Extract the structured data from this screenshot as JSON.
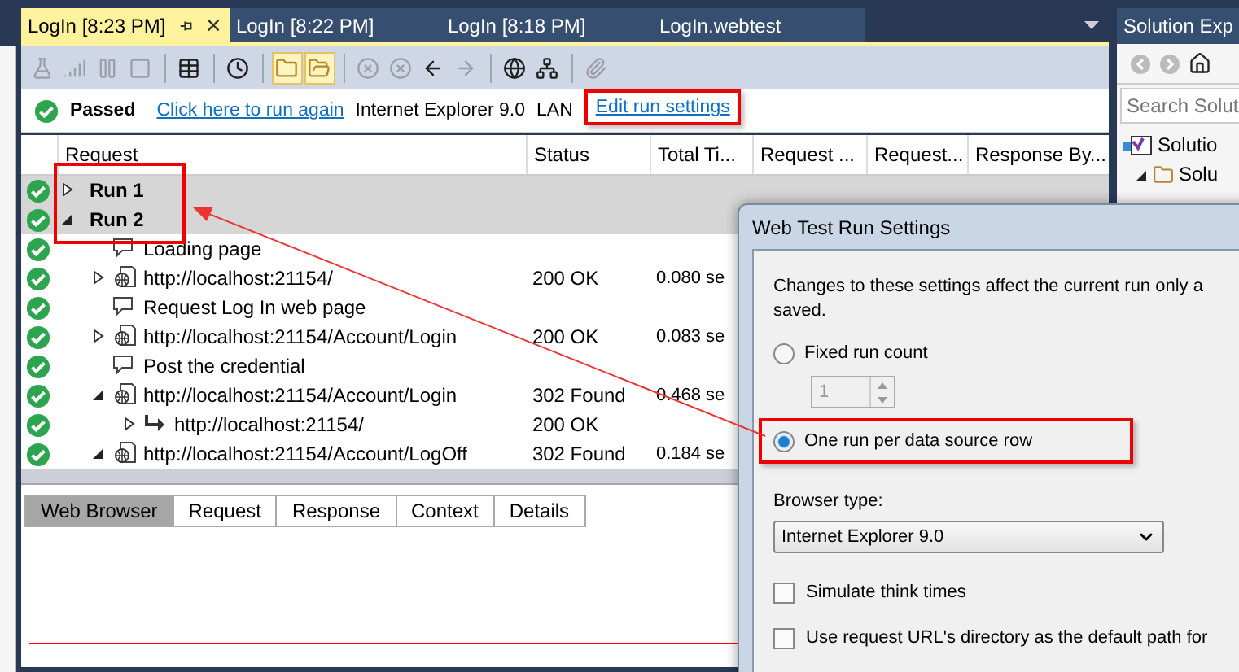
{
  "tabs": [
    {
      "label": "LogIn [8:23 PM]",
      "selected": true
    },
    {
      "label": "LogIn [8:22 PM]",
      "selected": false
    },
    {
      "label": "LogIn [8:18 PM]",
      "selected": false
    },
    {
      "label": "LogIn.webtest",
      "selected": false
    }
  ],
  "toolbar": [
    {
      "kind": "run",
      "disabled": true,
      "selected": false
    },
    {
      "kind": "step",
      "disabled": true,
      "selected": false
    },
    {
      "kind": "pause",
      "disabled": true,
      "selected": false
    },
    {
      "kind": "stop",
      "disabled": true,
      "selected": false
    },
    {
      "kind": "export",
      "disabled": false,
      "selected": false
    },
    {
      "kind": "history",
      "disabled": false,
      "selected": false
    },
    {
      "kind": "folder",
      "disabled": false,
      "selected": true
    },
    {
      "kind": "openfolder",
      "disabled": false,
      "selected": true
    },
    {
      "kind": "remove",
      "disabled": true,
      "selected": false
    },
    {
      "kind": "removeall",
      "disabled": true,
      "selected": false
    },
    {
      "kind": "back",
      "disabled": false,
      "selected": false
    },
    {
      "kind": "forward",
      "disabled": true,
      "selected": false
    },
    {
      "kind": "globe",
      "disabled": false,
      "selected": false
    },
    {
      "kind": "network",
      "disabled": false,
      "selected": false
    },
    {
      "kind": "attach",
      "disabled": true,
      "selected": false
    }
  ],
  "result_bar": {
    "passed": true,
    "status": "Passed",
    "run_again_link": "Click here to run again",
    "browser": "Internet Explorer 9.0",
    "network": "LAN",
    "settings_link": "Edit run settings"
  },
  "table": {
    "columns": [
      "Request",
      "Status",
      "Total Ti...",
      "Request ...",
      "Request...",
      "Response By..."
    ],
    "rows": [
      {
        "kind": "run",
        "label": "Run 1",
        "passed": true,
        "expanded": false
      },
      {
        "kind": "run",
        "label": "Run 2",
        "passed": true,
        "expanded": true,
        "children": [
          {
            "kind": "comment",
            "label": "Loading page",
            "passed": true
          },
          {
            "kind": "request",
            "label": "http://localhost:21154/",
            "status": "200 OK",
            "time": "0.080 se",
            "passed": true,
            "expanded": false
          },
          {
            "kind": "comment",
            "label": "Request Log In web page",
            "passed": true
          },
          {
            "kind": "request",
            "label": "http://localhost:21154/Account/Login",
            "status": "200 OK",
            "time": "0.083 se",
            "passed": true,
            "expanded": false
          },
          {
            "kind": "comment",
            "label": "Post the credential",
            "passed": true
          },
          {
            "kind": "request",
            "label": "http://localhost:21154/Account/Login",
            "status": "302 Found",
            "time": "0.468 se",
            "passed": true,
            "expanded": true,
            "children": [
              {
                "kind": "redirect",
                "label": "http://localhost:21154/",
                "status": "200 OK",
                "passed": true,
                "expanded": false
              }
            ]
          },
          {
            "kind": "request",
            "label": "http://localhost:21154/Account/LogOff",
            "status": "302 Found",
            "time": "0.184 se",
            "passed": true,
            "expanded": true
          }
        ]
      }
    ]
  },
  "detail_tabs": [
    {
      "label": "Web Browser",
      "selected": true
    },
    {
      "label": "Request",
      "selected": false
    },
    {
      "label": "Response",
      "selected": false
    },
    {
      "label": "Context",
      "selected": false
    },
    {
      "label": "Details",
      "selected": false
    }
  ],
  "dialog": {
    "title": "Web Test Run Settings",
    "intro": "Changes to these settings affect the current run only a",
    "intro_continued": "saved.",
    "fixed_run": {
      "label": "Fixed run count",
      "selected": false
    },
    "run_count": {
      "value": "1",
      "disabled": true
    },
    "per_row": {
      "label": "One run per data source row",
      "selected": true
    },
    "browser_label": "Browser type:",
    "browser_value": "Internet Explorer 9.0",
    "checkboxes": [
      {
        "label": "Simulate think times",
        "checked": false
      },
      {
        "label": "Use request URL's directory as the default path for",
        "checked": false
      }
    ]
  },
  "solution_explorer": {
    "title": "Solution Exp",
    "search": {
      "placeholder": "Search Solut"
    },
    "items": [
      {
        "label": "Solutio",
        "children": [
          {
            "label": "Solu",
            "expanded": true
          }
        ]
      }
    ]
  }
}
